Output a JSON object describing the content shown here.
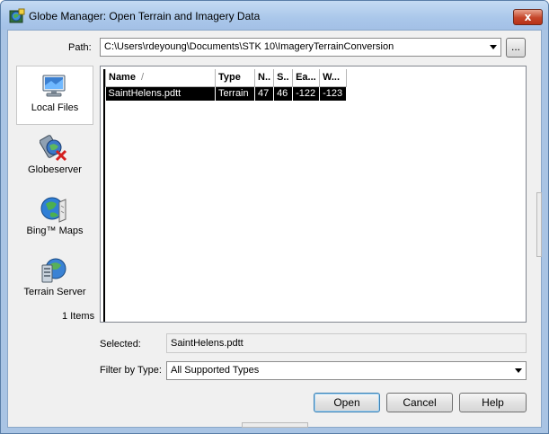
{
  "window": {
    "title": "Globe Manager: Open Terrain and Imagery Data",
    "close_glyph": "x"
  },
  "path": {
    "label": "Path:",
    "value": "C:\\Users\\rdeyoung\\Documents\\STK 10\\ImageryTerrainConversion",
    "browse_label": "..."
  },
  "sidebar": {
    "items": [
      {
        "label": "Local Files",
        "icon": "local-files-icon",
        "selected": true
      },
      {
        "label": "Globeserver",
        "icon": "globeserver-icon",
        "selected": false
      },
      {
        "label": "Bing™ Maps",
        "icon": "bing-maps-icon",
        "selected": false
      },
      {
        "label": "Terrain Server",
        "icon": "terrain-server-icon",
        "selected": false
      }
    ],
    "item_count": "1 Items"
  },
  "table": {
    "columns": [
      "Name",
      "Type",
      "N..",
      "S..",
      "Ea...",
      "W..."
    ],
    "rows": [
      {
        "name": "SaintHelens.pdtt",
        "type": "Terrain",
        "n": "47",
        "s": "46",
        "e": "-122",
        "w": "-123"
      }
    ]
  },
  "selected": {
    "label": "Selected:",
    "value": "SaintHelens.pdtt"
  },
  "filter": {
    "label": "Filter by Type:",
    "value": "All Supported Types"
  },
  "buttons": {
    "open": "Open",
    "cancel": "Cancel",
    "help": "Help"
  }
}
